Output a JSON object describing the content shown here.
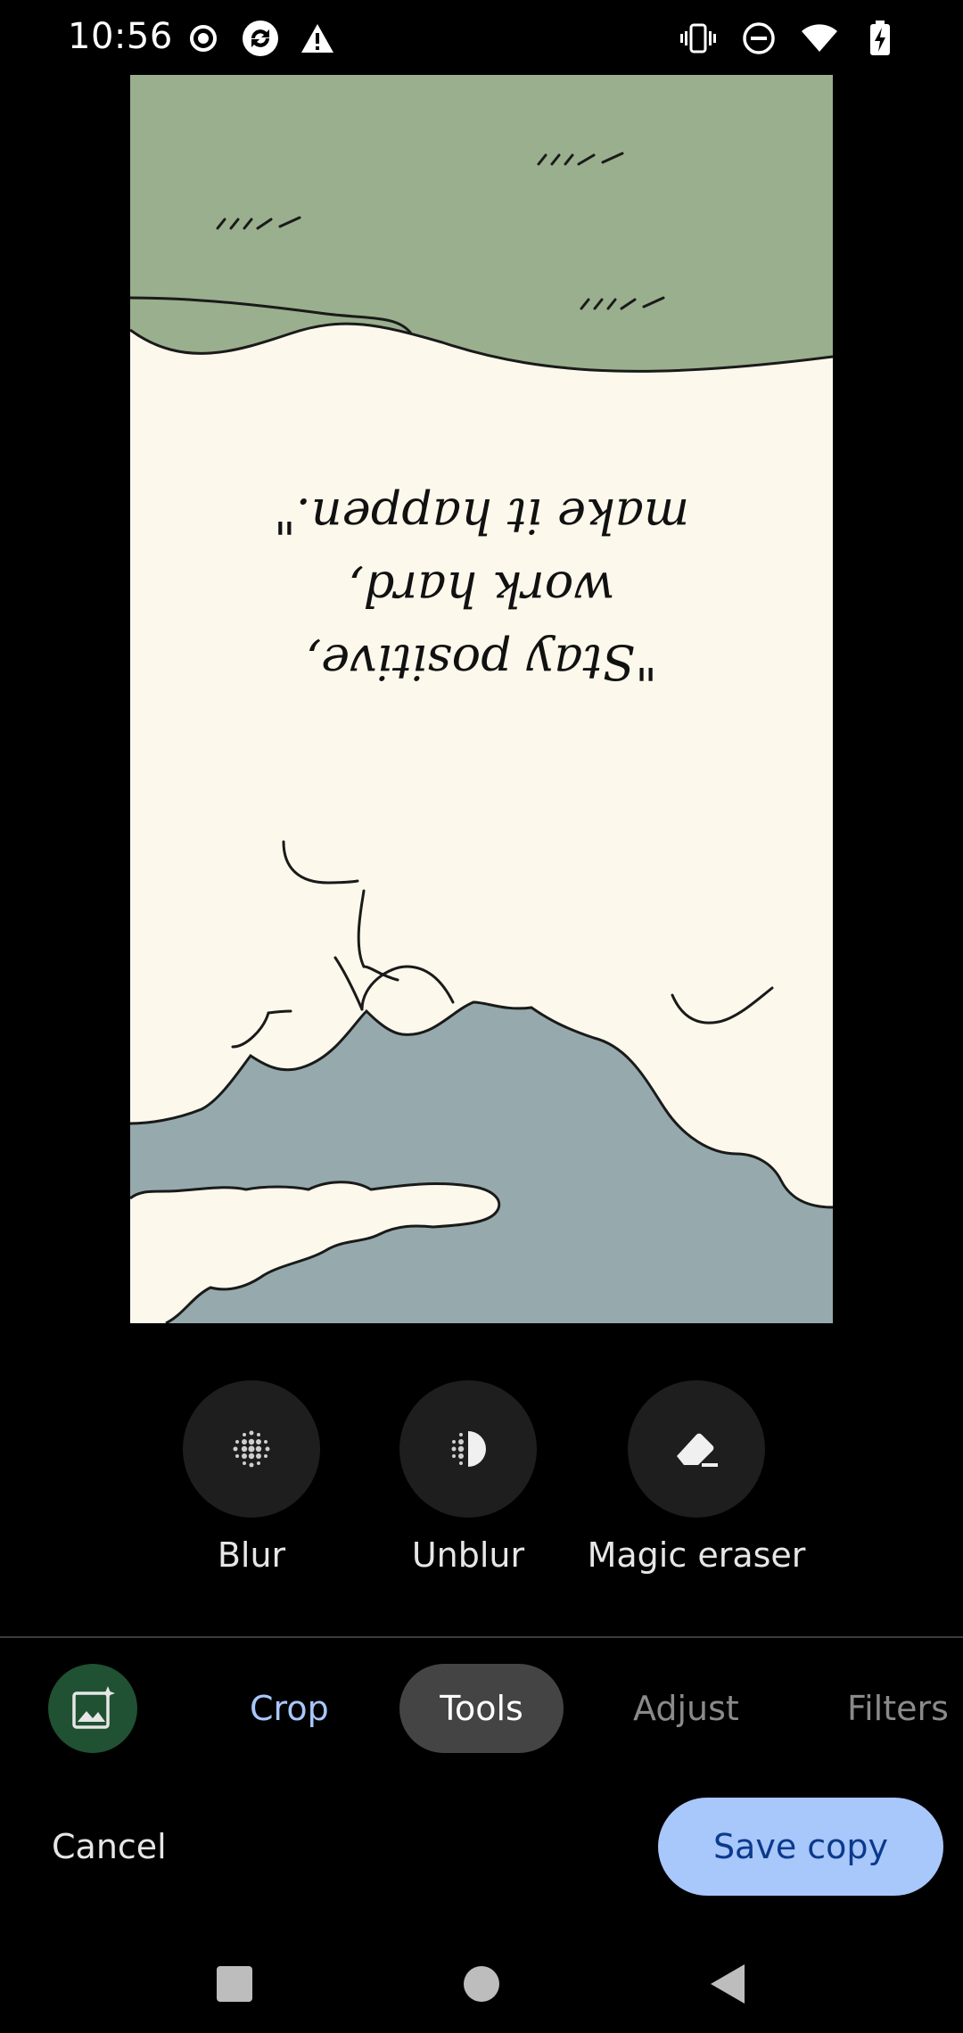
{
  "status_bar": {
    "time": "10:56",
    "left_icons": [
      "record-icon",
      "sync-app-icon",
      "warning-icon"
    ],
    "right_icons": [
      "vibrate-icon",
      "do-not-disturb-icon",
      "wifi-icon",
      "battery-charging-icon"
    ]
  },
  "photo": {
    "quote_line1": "\"Stay positive,",
    "quote_line2": "work hard,",
    "quote_line3": "make it happen.\"",
    "orientation": "rotated 180 degrees",
    "colors": {
      "top_hill": "#9aaf8d",
      "cream": "#fcf9ec",
      "sky_blue": "#96aaad",
      "outline": "#1a1a1a"
    }
  },
  "tools": [
    {
      "label": "Blur",
      "icon": "blur-dots-icon"
    },
    {
      "label": "Unblur",
      "icon": "unblur-icon"
    },
    {
      "label": "Magic eraser",
      "icon": "eraser-icon"
    }
  ],
  "tabs": {
    "enhance_icon": "auto-enhance-photo-icon",
    "crop": "Crop",
    "tools": "Tools",
    "adjust": "Adjust",
    "filters": "Filters",
    "selected": "Tools"
  },
  "actions": {
    "cancel": "Cancel",
    "save_copy": "Save copy"
  },
  "nav": {
    "icons": [
      "recents-square-icon",
      "home-circle-icon",
      "back-triangle-icon"
    ]
  },
  "colors": {
    "accent": "#a8c7fa",
    "save_text": "#0b3a8c",
    "enhance_bg": "#1f5132"
  }
}
